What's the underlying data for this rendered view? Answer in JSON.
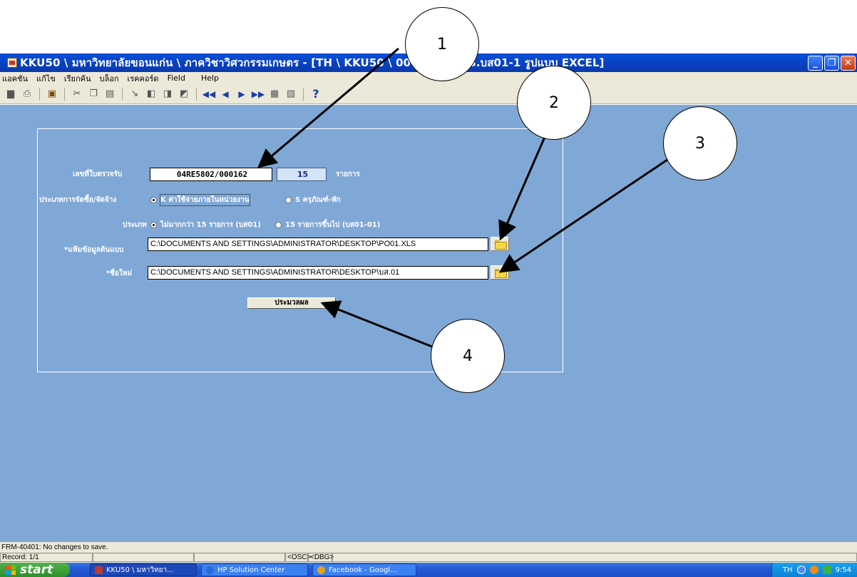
{
  "window": {
    "title": "KKU50 \\ มหาวิทยาลัยขอนแก่น \\ ภาควิชาวิศวกรรมเกษตร - [TH \\ KKU50 \\ 0011 \\ GFMIS.บส01-1 รูปแบบ EXCEL]",
    "minimize_label": "_",
    "maximize_label": "❐",
    "close_label": "✕"
  },
  "menu": {
    "items": [
      "แอคชัน",
      "แก้ไข",
      "เรียกค้น",
      "บล็อก",
      "เรคคอร์ด",
      "Field",
      "Help"
    ]
  },
  "form": {
    "receipt_label": "เลขที่ใบตรวจรับ",
    "receipt_number": "04RE5802/000162",
    "item_count": "15",
    "item_unit": "รายการ",
    "procurement_type_label": "ประเภทการจัดซื้อ/จัดจ้าง",
    "procurement_options": [
      {
        "label": "K ค่าใช้จ่ายภายในหน่วยงาน",
        "selected": true
      },
      {
        "label": "S ครุภัณฑ์-พัก",
        "selected": false
      }
    ],
    "type_label": "ประเภท",
    "type_options": [
      {
        "label": "ไม่มากกว่า 15 รายการ (บส01)",
        "selected": true
      },
      {
        "label": "15 รายการขึ้นไป (บส01-01)",
        "selected": false
      }
    ],
    "template_file_label": "*แฟ้มข้อมูลต้นแบบ",
    "template_file_path": "C:\\DOCUMENTS AND SETTINGS\\ADMINISTRATOR\\DESKTOP\\PO01.XLS",
    "new_name_label": "*ชื่อใหม่",
    "new_name_path": "C:\\DOCUMENTS AND SETTINGS\\ADMINISTRATOR\\DESKTOP\\บส.01",
    "process_button": "ประมวลผล"
  },
  "status": {
    "message": "FRM-40401: No changes to save.",
    "record": "Record: 1/1",
    "osc": "<OSC>",
    "dbg": "<DBG>"
  },
  "taskbar": {
    "start_label": "start",
    "tasks": [
      {
        "label": "KKU50 \\ มหาวิทยา...",
        "active": true,
        "color": "#c0392b"
      },
      {
        "label": "HP Solution Center",
        "active": false,
        "color": "#2a6ad8"
      },
      {
        "label": "Facebook - Googl...",
        "active": false,
        "color": "#e8a31c"
      }
    ],
    "language": "TH",
    "clock": "9:54"
  },
  "callouts": [
    "1",
    "2",
    "3",
    "4"
  ]
}
